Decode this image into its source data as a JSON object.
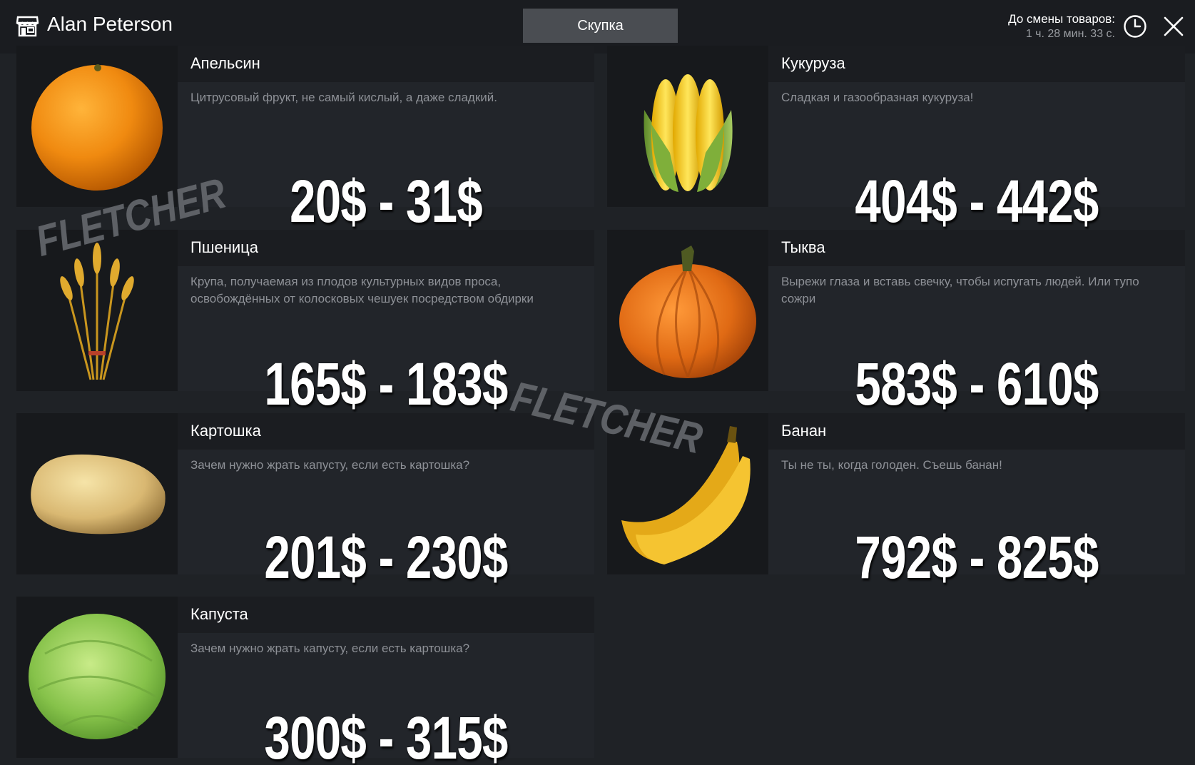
{
  "header": {
    "owner_name": "Alan Peterson",
    "tab_label": "Скупка",
    "timer_label": "До смены товаров:",
    "timer_value": "1 ч. 28 мин. 33 с.",
    "icons": [
      "shop-icon",
      "clock-icon",
      "close-icon"
    ]
  },
  "products": [
    {
      "name": "Апельсин",
      "description": "Цитрусовый фрукт, не самый кислый, а даже сладкий.",
      "price": "20$ - 31$",
      "icon": "orange-icon"
    },
    {
      "name": "Кукуруза",
      "description": "Сладкая и газообразная кукуруза!",
      "price": "404$ - 442$",
      "icon": "corn-icon"
    },
    {
      "name": "Пшеница",
      "description": "Крупа, получаемая из плодов культурных видов проса, освобождённых от колосковых чешуек посредством обдирки",
      "price": "165$ - 183$",
      "icon": "wheat-icon"
    },
    {
      "name": "Тыква",
      "description": "Вырежи глаза и вставь свечку, чтобы испугать людей. Или тупо сожри",
      "price": "583$ - 610$",
      "icon": "pumpkin-icon"
    },
    {
      "name": "Картошка",
      "description": "Зачем нужно жрать капусту, если есть картошка?",
      "price": "201$ - 230$",
      "icon": "potato-icon"
    },
    {
      "name": "Банан",
      "description": "Ты не ты, когда голоден. Съешь банан!",
      "price": "792$ - 825$",
      "icon": "banana-icon"
    },
    {
      "name": "Капуста",
      "description": "Зачем нужно жрать капусту, если есть картошка?",
      "price": "300$ - 315$",
      "icon": "cabbage-icon"
    }
  ],
  "watermarks": [
    "FLETCHER",
    "FLETCHER"
  ],
  "colors": {
    "background": "#1f2226",
    "header": "#1a1c20",
    "tab_active": "#4a4d52",
    "card_body": "#22252a",
    "card_title": "#1b1d21",
    "thumb": "#17191c",
    "description_text": "#8e9197"
  }
}
